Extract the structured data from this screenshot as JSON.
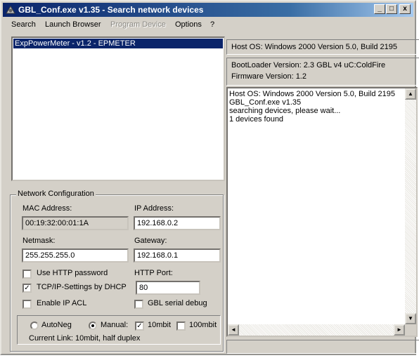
{
  "window": {
    "title": "GBL_Conf.exe v1.35  - Search network devices"
  },
  "title_buttons": {
    "minimize": "_",
    "maximize": "□",
    "close": "x"
  },
  "menu": {
    "items": [
      {
        "label": "Search",
        "enabled": true
      },
      {
        "label": "Launch Browser",
        "enabled": true
      },
      {
        "label": "Program Device",
        "enabled": false
      },
      {
        "label": "Options",
        "enabled": true
      },
      {
        "label": "?",
        "enabled": true
      }
    ]
  },
  "device_list": {
    "items": [
      "ExpPowerMeter - v1.2 - EPMETER"
    ],
    "selected_index": 0
  },
  "network_config": {
    "title": "Network Configuration",
    "mac_label": "MAC Address:",
    "mac_value": "00:19:32:00:01:1A",
    "ip_label": "IP Address:",
    "ip_value": "192.168.0.2",
    "netmask_label": "Netmask:",
    "netmask_value": "255.255.255.0",
    "gateway_label": "Gateway:",
    "gateway_value": "192.168.0.1",
    "use_http_password_label": "Use HTTP password",
    "use_http_password": false,
    "http_port_label": "HTTP Port:",
    "http_port_value": "80",
    "tcpip_dhcp_label": "TCP/IP-Settings by DHCP",
    "tcpip_dhcp": true,
    "enable_ip_acl_label": "Enable IP ACL",
    "enable_ip_acl": false,
    "gbl_serial_debug_label": "GBL serial debug",
    "gbl_serial_debug": false
  },
  "link": {
    "autoneg_label": "AutoNeg",
    "manual_label": "Manual:",
    "mode": "manual",
    "mbit10_label": "10mbit",
    "mbit10": true,
    "mbit100_label": "100mbit",
    "mbit100": false,
    "current_link": "Current Link: 10mbit, half duplex"
  },
  "info": {
    "host_os": "Host OS: Windows 2000 Version 5.0, Build 2195",
    "bootloader": "BootLoader Version: 2.3    GBL v4    uC:ColdFire",
    "firmware": "Firmware Version: 1.2"
  },
  "log": {
    "lines": [
      "Host OS: Windows 2000 Version 5.0, Build 2195",
      "GBL_Conf.exe v1.35",
      "searching devices, please wait...",
      "1 devices found"
    ]
  },
  "scroll_glyphs": {
    "up": "▲",
    "down": "▼",
    "left": "◄",
    "right": "►"
  },
  "check_glyph": "✓"
}
